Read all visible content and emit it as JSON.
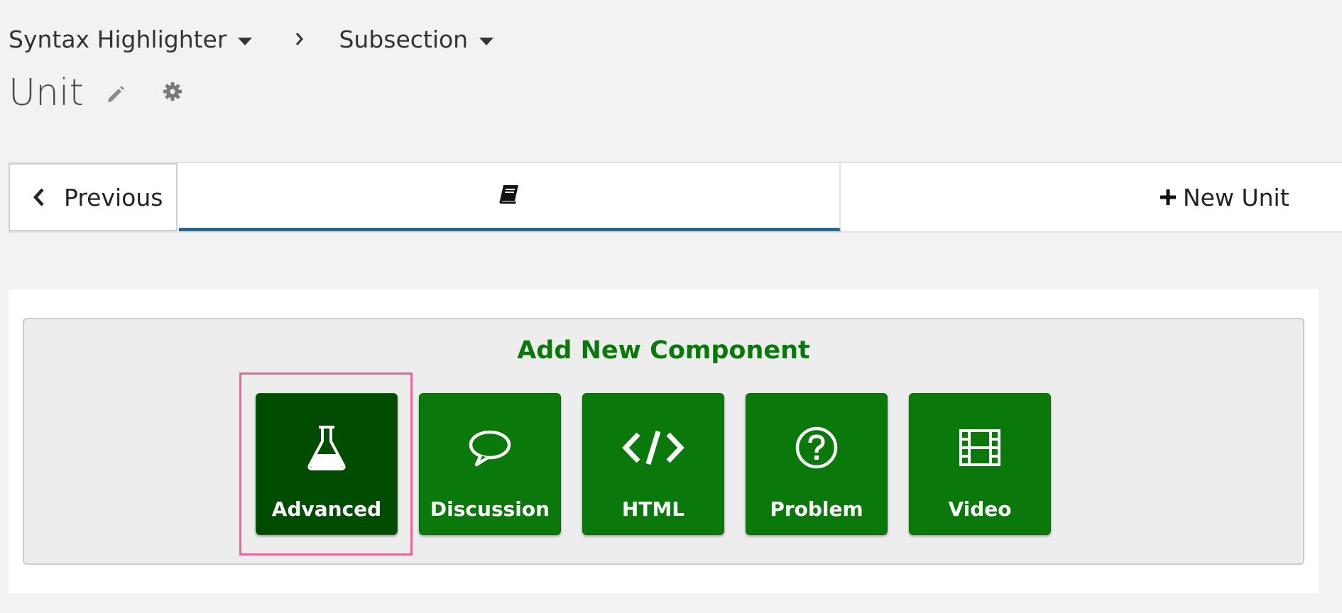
{
  "breadcrumb": {
    "section": "Syntax Highlighter",
    "subsection": "Subsection"
  },
  "unit": {
    "title": "Unit"
  },
  "nav": {
    "previous_label": "Previous",
    "new_unit_label": "New Unit",
    "active_tab_icon": "book-icon",
    "active_tab_color": "#1f6a96"
  },
  "add_component": {
    "title": "Add New Component",
    "title_color": "#0b780b",
    "button_color": "#0a780a",
    "active_button_color": "#004c00",
    "highlight_color": "#e8679a",
    "buttons": [
      {
        "label": "Advanced",
        "icon": "flask-icon",
        "active": true
      },
      {
        "label": "Discussion",
        "icon": "speech-bubble-icon",
        "active": false
      },
      {
        "label": "HTML",
        "icon": "code-icon",
        "active": false
      },
      {
        "label": "Problem",
        "icon": "question-circle-icon",
        "active": false
      },
      {
        "label": "Video",
        "icon": "film-icon",
        "active": false
      }
    ]
  }
}
